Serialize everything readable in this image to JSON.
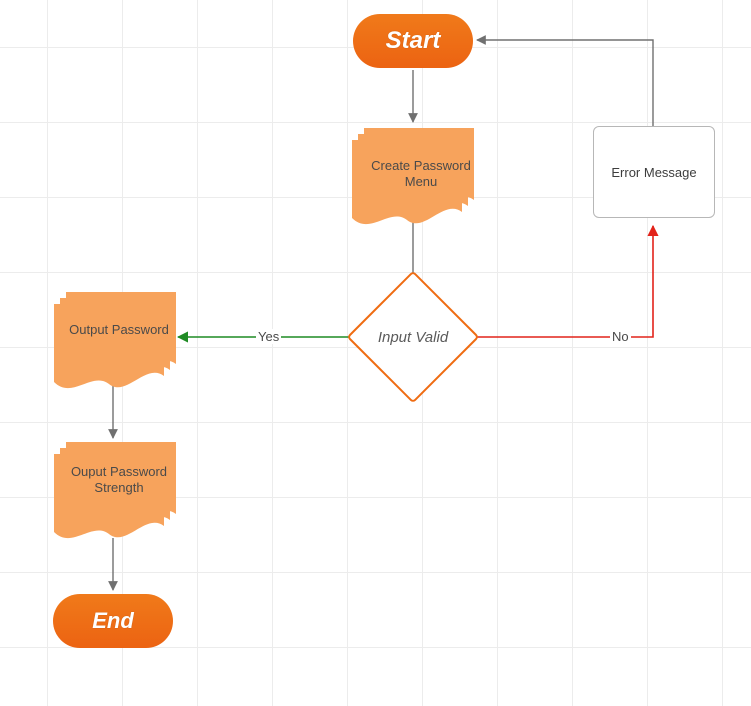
{
  "chart_data": {
    "type": "flowchart",
    "nodes": [
      {
        "id": "start",
        "kind": "terminator",
        "label": "Start"
      },
      {
        "id": "menu",
        "kind": "document",
        "label": "Create Password Menu"
      },
      {
        "id": "valid",
        "kind": "decision",
        "label": "Input Valid"
      },
      {
        "id": "error",
        "kind": "process",
        "label": "Error Message"
      },
      {
        "id": "outpwd",
        "kind": "document",
        "label": "Output Password"
      },
      {
        "id": "strength",
        "kind": "document",
        "label": "Ouput Password Strength"
      },
      {
        "id": "end",
        "kind": "terminator",
        "label": "End"
      }
    ],
    "edges": [
      {
        "from": "start",
        "to": "menu",
        "label": "",
        "color": "gray"
      },
      {
        "from": "menu",
        "to": "valid",
        "label": "",
        "color": "gray"
      },
      {
        "from": "valid",
        "to": "outpwd",
        "label": "Yes",
        "color": "green"
      },
      {
        "from": "valid",
        "to": "error",
        "label": "No",
        "color": "red"
      },
      {
        "from": "error",
        "to": "start",
        "label": "",
        "color": "gray"
      },
      {
        "from": "outpwd",
        "to": "strength",
        "label": "",
        "color": "gray"
      },
      {
        "from": "strength",
        "to": "end",
        "label": "",
        "color": "gray"
      }
    ]
  },
  "nodes": {
    "start": {
      "label": "Start"
    },
    "menu": {
      "label": "Create Password Menu"
    },
    "valid": {
      "label": "Input Valid"
    },
    "error": {
      "label": "Error Message"
    },
    "outpwd": {
      "label": "Output Password"
    },
    "strength": {
      "label": "Ouput Password Strength"
    },
    "end": {
      "label": "End"
    }
  },
  "edge_labels": {
    "yes": "Yes",
    "no": "No"
  }
}
